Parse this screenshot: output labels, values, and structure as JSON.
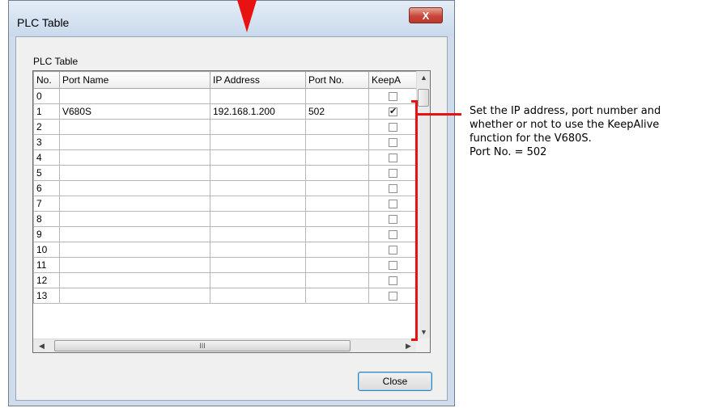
{
  "window": {
    "title": "PLC Table",
    "close_glyph": "X"
  },
  "group": {
    "label": "PLC Table"
  },
  "table": {
    "headers": [
      "No.",
      "Port Name",
      "IP Address",
      "Port No.",
      "KeepA"
    ],
    "rows": [
      {
        "no": "0",
        "name": "",
        "ip": "",
        "port": "",
        "keepalive": false
      },
      {
        "no": "1",
        "name": "V680S",
        "ip": "192.168.1.200",
        "port": "502",
        "keepalive": true
      },
      {
        "no": "2",
        "name": "",
        "ip": "",
        "port": "",
        "keepalive": false
      },
      {
        "no": "3",
        "name": "",
        "ip": "",
        "port": "",
        "keepalive": false
      },
      {
        "no": "4",
        "name": "",
        "ip": "",
        "port": "",
        "keepalive": false
      },
      {
        "no": "5",
        "name": "",
        "ip": "",
        "port": "",
        "keepalive": false
      },
      {
        "no": "6",
        "name": "",
        "ip": "",
        "port": "",
        "keepalive": false
      },
      {
        "no": "7",
        "name": "",
        "ip": "",
        "port": "",
        "keepalive": false
      },
      {
        "no": "8",
        "name": "",
        "ip": "",
        "port": "",
        "keepalive": false
      },
      {
        "no": "9",
        "name": "",
        "ip": "",
        "port": "",
        "keepalive": false
      },
      {
        "no": "10",
        "name": "",
        "ip": "",
        "port": "",
        "keepalive": false
      },
      {
        "no": "11",
        "name": "",
        "ip": "",
        "port": "",
        "keepalive": false
      },
      {
        "no": "12",
        "name": "",
        "ip": "",
        "port": "",
        "keepalive": false
      },
      {
        "no": "13",
        "name": "",
        "ip": "",
        "port": "",
        "keepalive": false
      }
    ]
  },
  "scrollbar": {
    "grip": "III"
  },
  "buttons": {
    "close": "Close"
  },
  "annotation": {
    "lines": [
      "Set the IP address, port number and",
      "whether or not to use the KeepAlive",
      "function for the V680S.",
      "Port No. = 502"
    ]
  },
  "colors": {
    "annotation": "#e81212",
    "button_border": "#3c7fb1"
  }
}
